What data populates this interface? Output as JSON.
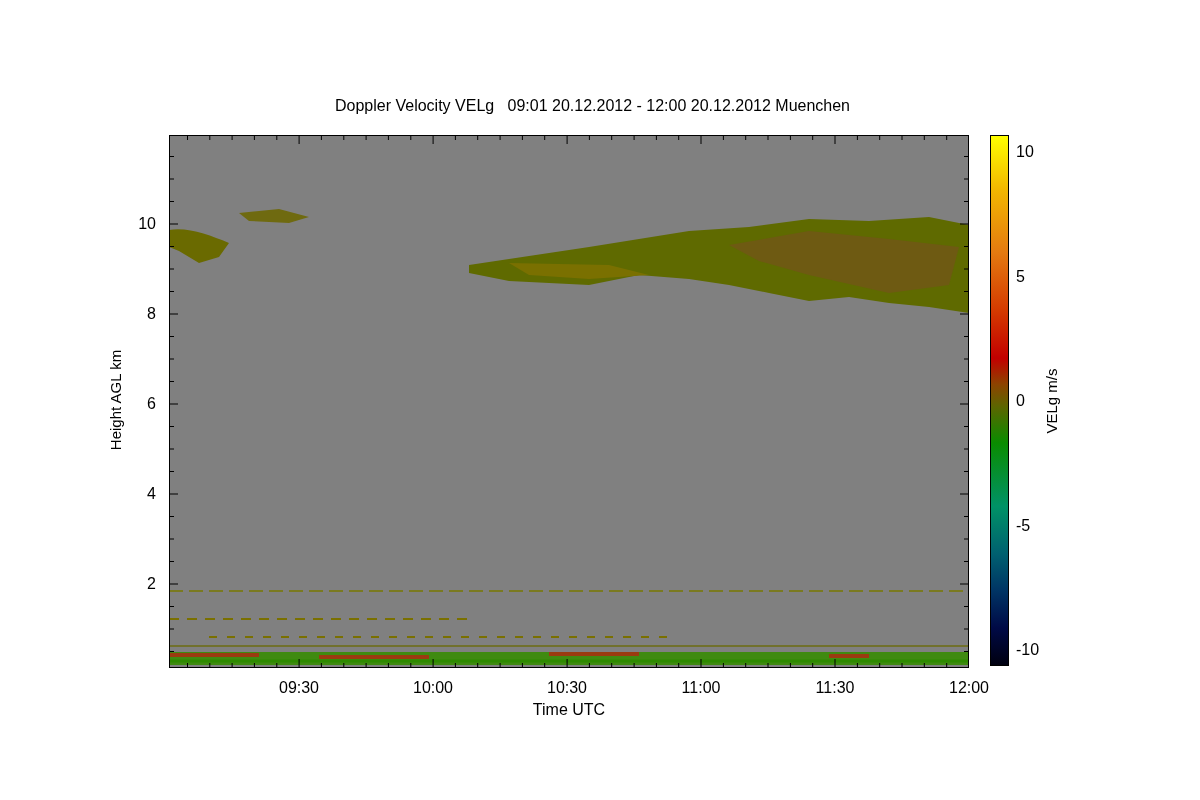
{
  "figure": {
    "title": "Doppler Velocity VELg   09:01 20.12.2012 - 12:00 20.12.2012 Muenchen",
    "y_axis": {
      "label": "Height AGL km",
      "ticks": [
        "10",
        "8",
        "6",
        "4",
        "2"
      ]
    },
    "x_axis": {
      "label": "Time UTC",
      "ticks": [
        "09:30",
        "10:00",
        "10:30",
        "11:00",
        "11:30",
        "12:00"
      ]
    },
    "colorbar": {
      "label": "VELg m/s",
      "ticks": [
        "10",
        "5",
        "0",
        "-5",
        "-10"
      ]
    }
  }
}
